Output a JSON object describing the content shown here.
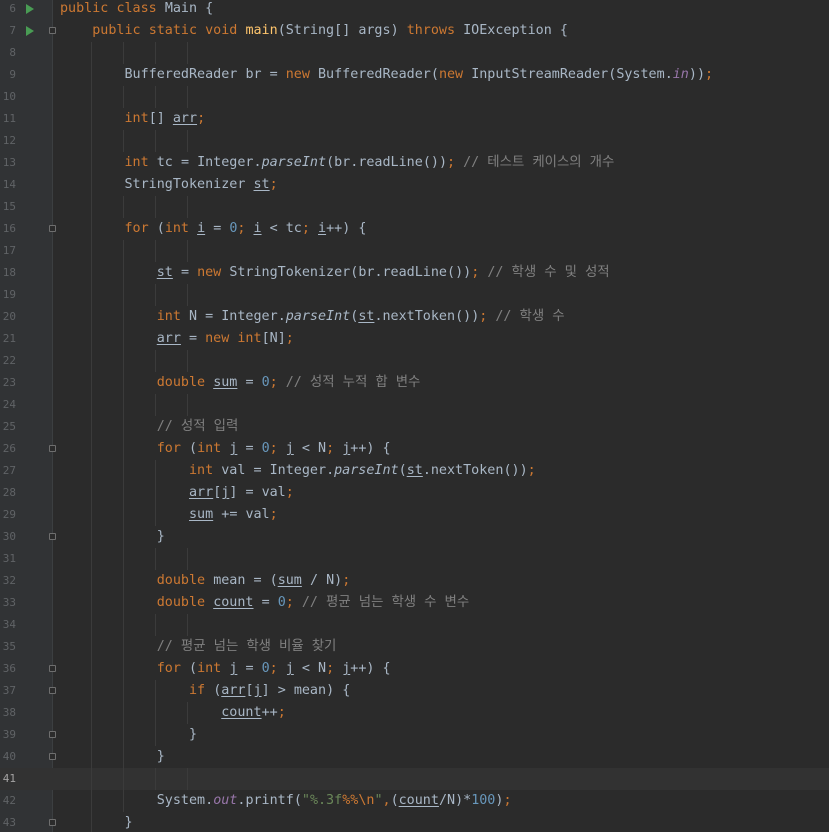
{
  "editor": {
    "current_line": 41,
    "lines": [
      {
        "n": 6,
        "text": "public class Main {"
      },
      {
        "n": 7,
        "text": "    public static void main(String[] args) throws IOException {"
      },
      {
        "n": 8,
        "text": ""
      },
      {
        "n": 9,
        "text": "        BufferedReader br = new BufferedReader(new InputStreamReader(System.in));"
      },
      {
        "n": 10,
        "text": ""
      },
      {
        "n": 11,
        "text": "        int[] arr;"
      },
      {
        "n": 12,
        "text": ""
      },
      {
        "n": 13,
        "text": "        int tc = Integer.parseInt(br.readLine()); // 테스트 케이스의 개수"
      },
      {
        "n": 14,
        "text": "        StringTokenizer st;"
      },
      {
        "n": 15,
        "text": ""
      },
      {
        "n": 16,
        "text": "        for (int i = 0; i < tc; i++) {"
      },
      {
        "n": 17,
        "text": ""
      },
      {
        "n": 18,
        "text": "            st = new StringTokenizer(br.readLine()); // 학생 수 및 성적"
      },
      {
        "n": 19,
        "text": ""
      },
      {
        "n": 20,
        "text": "            int N = Integer.parseInt(st.nextToken()); // 학생 수"
      },
      {
        "n": 21,
        "text": "            arr = new int[N];"
      },
      {
        "n": 22,
        "text": ""
      },
      {
        "n": 23,
        "text": "            double sum = 0; // 성적 누적 합 변수"
      },
      {
        "n": 24,
        "text": ""
      },
      {
        "n": 25,
        "text": "            // 성적 입력"
      },
      {
        "n": 26,
        "text": "            for (int j = 0; j < N; j++) {"
      },
      {
        "n": 27,
        "text": "                int val = Integer.parseInt(st.nextToken());"
      },
      {
        "n": 28,
        "text": "                arr[j] = val;"
      },
      {
        "n": 29,
        "text": "                sum += val;"
      },
      {
        "n": 30,
        "text": "            }"
      },
      {
        "n": 31,
        "text": ""
      },
      {
        "n": 32,
        "text": "            double mean = (sum / N);"
      },
      {
        "n": 33,
        "text": "            double count = 0; // 평균 넘는 학생 수 변수"
      },
      {
        "n": 34,
        "text": ""
      },
      {
        "n": 35,
        "text": "            // 평균 넘는 학생 비율 찾기"
      },
      {
        "n": 36,
        "text": "            for (int j = 0; j < N; j++) {"
      },
      {
        "n": 37,
        "text": "                if (arr[j] > mean) {"
      },
      {
        "n": 38,
        "text": "                    count++;"
      },
      {
        "n": 39,
        "text": "                }"
      },
      {
        "n": 40,
        "text": "            }"
      },
      {
        "n": 41,
        "text": ""
      },
      {
        "n": 42,
        "text": "            System.out.printf(\"%.3f%%\\n\",(count/N)*100);"
      },
      {
        "n": 43,
        "text": "        }"
      }
    ]
  },
  "gutter_icons": {
    "run_lines": [
      6,
      7
    ],
    "fold_lines": [
      7,
      16,
      26,
      30,
      36,
      37,
      39,
      40,
      43
    ],
    "run_icon": "run-arrow-icon",
    "fold_icon": "fold-marker-icon"
  },
  "theme": {
    "background": "#2b2b2b",
    "gutter": "#313335",
    "keyword": "#cc7832",
    "method": "#ffc66d",
    "number": "#6897bb",
    "string": "#6a8759",
    "comment": "#808080",
    "field": "#9876aa",
    "text": "#a9b7c6",
    "run_icon": "#499c54"
  }
}
